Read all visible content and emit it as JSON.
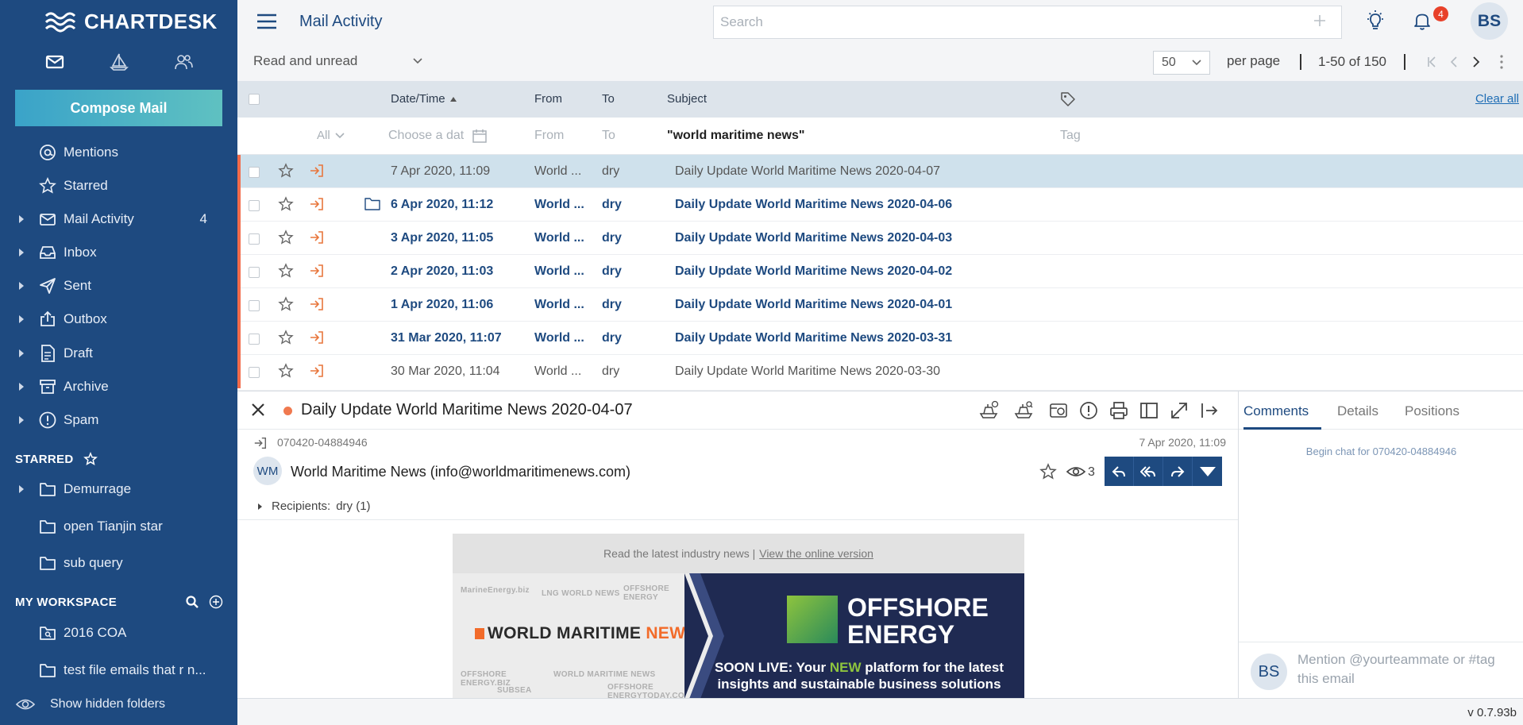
{
  "app": {
    "logo_text": "CHARTDESK",
    "version": "v 0.7.93b"
  },
  "sidebar": {
    "compose_label": "Compose Mail",
    "nav": [
      {
        "label": "Mentions",
        "icon": "at-icon"
      },
      {
        "label": "Starred",
        "icon": "star-icon"
      },
      {
        "label": "Mail Activity",
        "icon": "mail-icon",
        "count": "4"
      },
      {
        "label": "Inbox",
        "icon": "inbox-icon"
      },
      {
        "label": "Sent",
        "icon": "send-icon"
      },
      {
        "label": "Outbox",
        "icon": "outbox-icon"
      },
      {
        "label": "Draft",
        "icon": "draft-icon"
      },
      {
        "label": "Archive",
        "icon": "archive-icon"
      },
      {
        "label": "Spam",
        "icon": "spam-icon"
      }
    ],
    "starred_header": "STARRED",
    "starred_items": [
      "Demurrage",
      "open Tianjin star",
      "sub query"
    ],
    "workspace_header": "MY WORKSPACE",
    "workspace_items": [
      "2016 COA",
      "test file emails that r n..."
    ],
    "show_hidden": "Show hidden folders"
  },
  "header": {
    "title": "Mail Activity",
    "search_placeholder": "Search",
    "notification_count": "4",
    "avatar_initials": "BS"
  },
  "toolbar": {
    "read_filter": "Read and unread",
    "per_page_value": "50",
    "per_page_label": "per page",
    "range": "1-50 of 150"
  },
  "table": {
    "columns": {
      "date": "Date/Time",
      "from": "From",
      "to": "To",
      "subject": "Subject"
    },
    "clear_all": "Clear all",
    "filters": {
      "all": "All",
      "date_placeholder": "Choose a dat",
      "from": "From",
      "to": "To",
      "subject": "\"world maritime news\"",
      "tag": "Tag"
    },
    "rows": [
      {
        "date": "7 Apr 2020, 11:09",
        "from": "World ...",
        "to": "dry",
        "subject": "Daily Update World Maritime News 2020-04-07",
        "unread": false,
        "selected": true,
        "folder": false
      },
      {
        "date": "6 Apr 2020, 11:12",
        "from": "World ...",
        "to": "dry",
        "subject": "Daily Update World Maritime News 2020-04-06",
        "unread": true,
        "selected": false,
        "folder": true
      },
      {
        "date": "3 Apr 2020, 11:05",
        "from": "World ...",
        "to": "dry",
        "subject": "Daily Update World Maritime News 2020-04-03",
        "unread": true,
        "selected": false,
        "folder": false
      },
      {
        "date": "2 Apr 2020, 11:03",
        "from": "World ...",
        "to": "dry",
        "subject": "Daily Update World Maritime News 2020-04-02",
        "unread": true,
        "selected": false,
        "folder": false
      },
      {
        "date": "1 Apr 2020, 11:06",
        "from": "World ...",
        "to": "dry",
        "subject": "Daily Update World Maritime News 2020-04-01",
        "unread": true,
        "selected": false,
        "folder": false
      },
      {
        "date": "31 Mar 2020, 11:07",
        "from": "World ...",
        "to": "dry",
        "subject": "Daily Update World Maritime News 2020-03-31",
        "unread": true,
        "selected": false,
        "folder": false
      },
      {
        "date": "30 Mar 2020, 11:04",
        "from": "World ...",
        "to": "dry",
        "subject": "Daily Update World Maritime News 2020-03-30",
        "unread": false,
        "selected": false,
        "folder": false
      }
    ]
  },
  "reader": {
    "title": "Daily Update World Maritime News 2020-04-07",
    "message_id": "070420-04884946",
    "date": "7 Apr 2020, 11:09",
    "sender_initials": "WM",
    "sender": "World Maritime News (info@worldmaritimenews.com)",
    "views": "3",
    "recipients_label": "Recipients:",
    "recipients_value": "dry (1)",
    "newsletter": {
      "top_text": "Read the latest industry news |",
      "top_link": "View the online version",
      "brand_main": "WORLD MARITIME ",
      "brand_accent": "NEWS",
      "oe_line1": "OFFSHORE",
      "oe_line2": "ENERGY",
      "promo_a": "SOON LIVE: Your ",
      "promo_new": "NEW",
      "promo_b": " platform for the latest insights and sustainable business solutions",
      "faint": [
        "MarineEnergy.biz",
        "LNG WORLD NEWS",
        "OFFSHORE ENERGY",
        "OFFSHORE ENERGY.BIZ",
        "WORLD MARITIME NEWS",
        "SUBSEA",
        "OFFSHORE ENERGYTODAY.COM"
      ]
    }
  },
  "right_panel": {
    "tabs": [
      "Comments",
      "Details",
      "Positions"
    ],
    "begin_chat": "Begin chat for 070420-04884946",
    "comment_placeholder": "Mention @yourteammate or #tag this email",
    "avatar_initials": "BS"
  },
  "colors": {
    "sidebar": "#1e4a80",
    "accent": "#f26b4a",
    "selected_row": "#cfe1ec",
    "header_row": "#dde4eb"
  }
}
